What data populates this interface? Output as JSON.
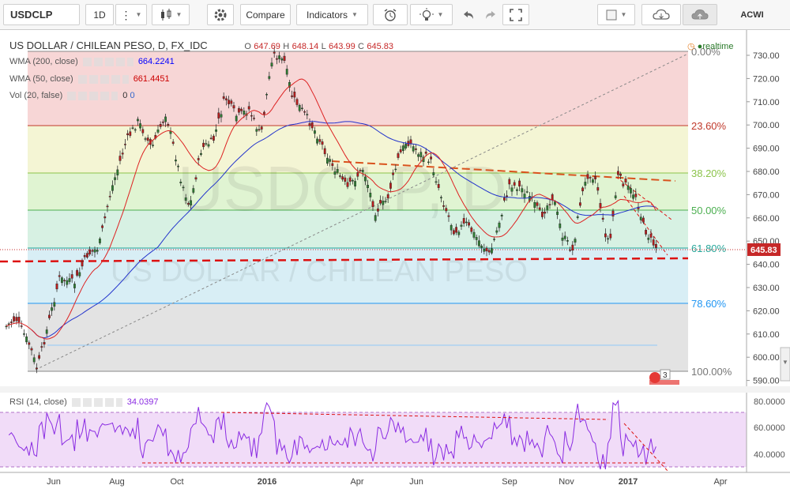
{
  "toolbar": {
    "symbol": "USDCLP",
    "interval": "1D",
    "compare_label": "Compare",
    "indicators_label": "Indicators",
    "right_symbol": "ACWI"
  },
  "legend": {
    "title": "US DOLLAR / CHILEAN PESO, D, FX_IDC",
    "o_label": "O",
    "o": "647.69",
    "h_label": "H",
    "h": "648.14",
    "l_label": "L",
    "l": "643.99",
    "c_label": "C",
    "c": "645.83",
    "realtime": "realtime"
  },
  "indicators": [
    {
      "label": "WMA (200, close)",
      "value": "664.2241",
      "color": "#0000ff"
    },
    {
      "label": "WMA (50, close)",
      "value": "661.4451",
      "color": "#cc0000"
    },
    {
      "label": "Vol (20, false)",
      "value": "0",
      "value2": "0",
      "color": "#3366cc"
    }
  ],
  "watermark": {
    "big": "USDCLP, D",
    "small": "US DOLLAR / CHILEAN PESO"
  },
  "fib_levels": [
    "0.00%",
    "23.60%",
    "38.20%",
    "50.00%",
    "61.80%",
    "78.60%",
    "100.00%"
  ],
  "price_axis": [
    "730.00",
    "720.00",
    "710.00",
    "700.00",
    "690.00",
    "680.00",
    "670.00",
    "660.00",
    "650.00",
    "640.00",
    "630.00",
    "620.00",
    "610.00",
    "600.00",
    "590.00"
  ],
  "price_tag": "645.83",
  "rsi": {
    "label": "RSI (14, close)",
    "value": "34.0397",
    "axis": [
      "80.0000",
      "60.0000",
      "40.0000"
    ]
  },
  "time_axis": [
    "Jun",
    "Aug",
    "Oct",
    "2016",
    "Apr",
    "Jun",
    "Sep",
    "Nov",
    "2017",
    "Apr"
  ],
  "events_badge": "3",
  "colors": {
    "sma200": "#2233cc",
    "sma50": "#dd2222",
    "up": "#2e7d32",
    "down": "#b71c1c",
    "rsi": "#8a2be2"
  }
}
